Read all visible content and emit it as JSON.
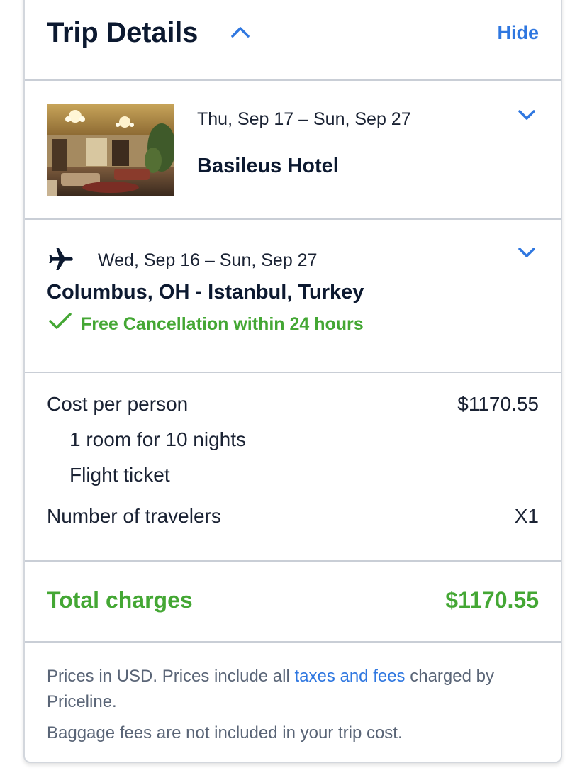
{
  "header": {
    "title": "Trip Details",
    "hide_label": "Hide"
  },
  "hotel": {
    "dates": "Thu, Sep 17 – Sun, Sep 27",
    "name": "Basileus Hotel"
  },
  "flight": {
    "dates": "Wed, Sep 16 – Sun, Sep 27",
    "route": "Columbus, OH - Istanbul, Turkey",
    "cancellation": "Free Cancellation within 24 hours"
  },
  "cost": {
    "per_person_label": "Cost per person",
    "per_person_value": "$1170.55",
    "room_line": "1 room for 10 nights",
    "flight_line": "Flight ticket",
    "travelers_label": "Number of travelers",
    "travelers_value": "X1"
  },
  "total": {
    "label": "Total charges",
    "value": "$1170.55"
  },
  "footer": {
    "text_before_link": "Prices in USD. Prices include all ",
    "link_text": "taxes and fees",
    "text_after_link": " charged by Priceline.",
    "baggage_note": "Baggage fees are not included in your trip cost."
  },
  "colors": {
    "accent_blue": "#2f77e0",
    "success_green": "#44a734",
    "text_dark": "#0c1930"
  },
  "icons": [
    "chevron-up-icon",
    "chevron-down-icon",
    "airplane-icon",
    "checkmark-icon"
  ]
}
